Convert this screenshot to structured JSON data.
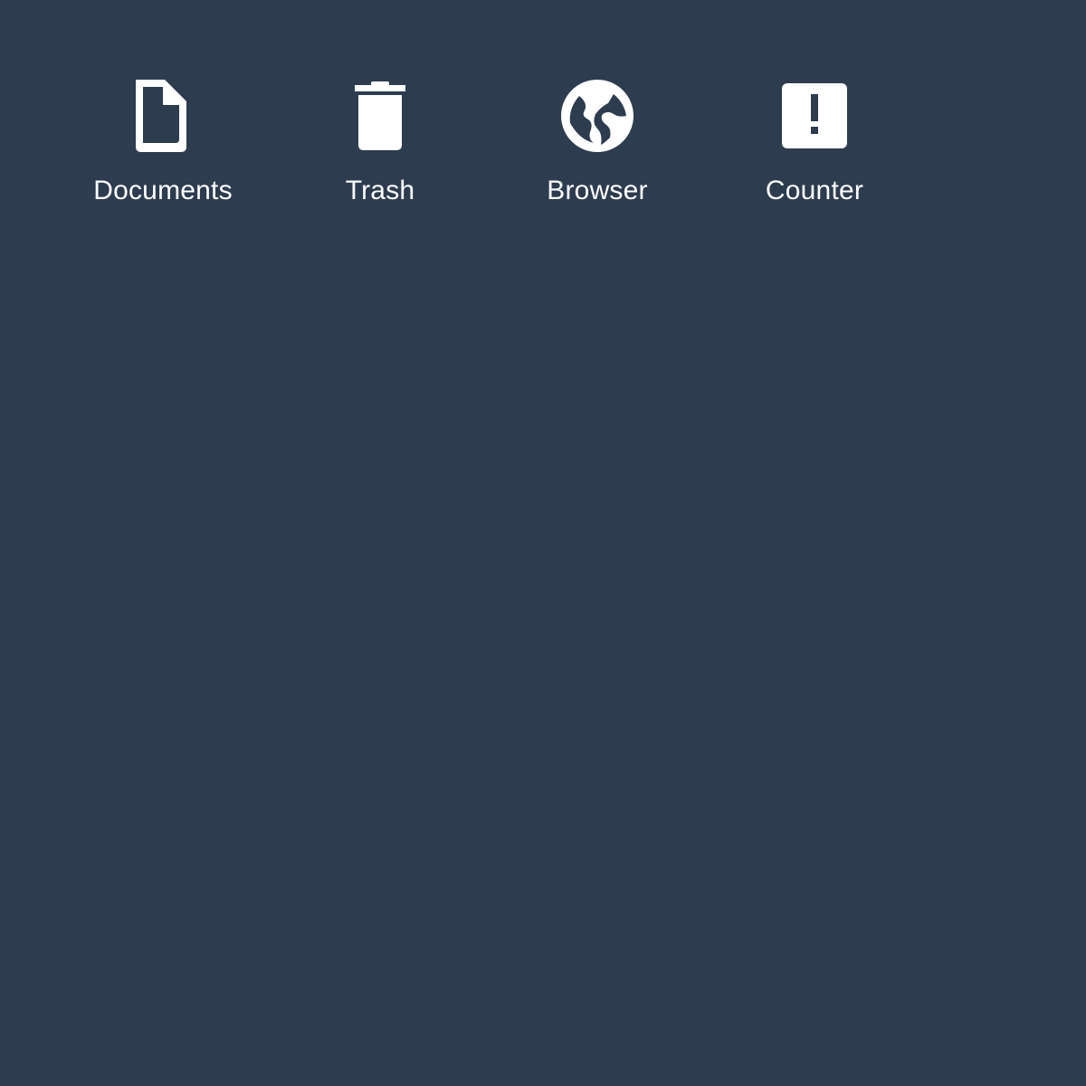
{
  "desktop": {
    "background_color": "#2d3c4f",
    "icon_color": "#ffffff",
    "icons": [
      {
        "label": "Documents",
        "icon": "document-icon"
      },
      {
        "label": "Trash",
        "icon": "trash-icon"
      },
      {
        "label": "Browser",
        "icon": "globe-icon"
      },
      {
        "label": "Counter",
        "icon": "alert-box-icon"
      }
    ]
  }
}
